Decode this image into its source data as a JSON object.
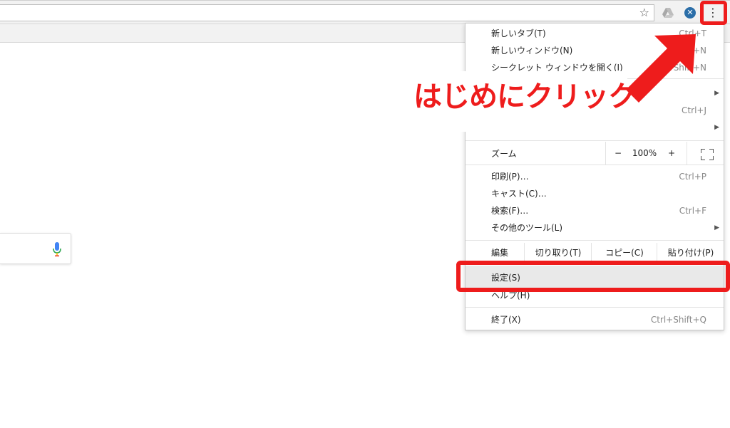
{
  "menu": {
    "new_tab": {
      "label": "新しいタブ(T)",
      "shortcut": "Ctrl+T"
    },
    "new_window": {
      "label": "新しいウィンドウ(N)",
      "shortcut": "Ctrl+N"
    },
    "incognito": {
      "label": "シークレット ウィンドウを開く(I)",
      "shortcut": "Ctrl+Shift+N"
    },
    "bookmarks_shortcut": "Ctrl+J",
    "zoom": {
      "label": "ズーム",
      "minus": "−",
      "value": "100%",
      "plus": "+"
    },
    "print": {
      "label": "印刷(P)…",
      "shortcut": "Ctrl+P"
    },
    "cast": {
      "label": "キャスト(C)…"
    },
    "find": {
      "label": "検索(F)…",
      "shortcut": "Ctrl+F"
    },
    "more_tools": {
      "label": "その他のツール(L)"
    },
    "edit": {
      "label": "編集",
      "cut": "切り取り(T)",
      "copy": "コピー(C)",
      "paste": "貼り付け(P)"
    },
    "settings": {
      "label": "設定(S)"
    },
    "help": {
      "label": "ヘルプ(H)"
    },
    "exit": {
      "label": "終了(X)",
      "shortcut": "Ctrl+Shift+Q"
    }
  },
  "annotation": {
    "text": "はじめにクリック",
    "color": "#ee1c1c"
  },
  "colors": {
    "accent_red": "#ee1c1c",
    "menu_hover": "#e9e9e9"
  }
}
